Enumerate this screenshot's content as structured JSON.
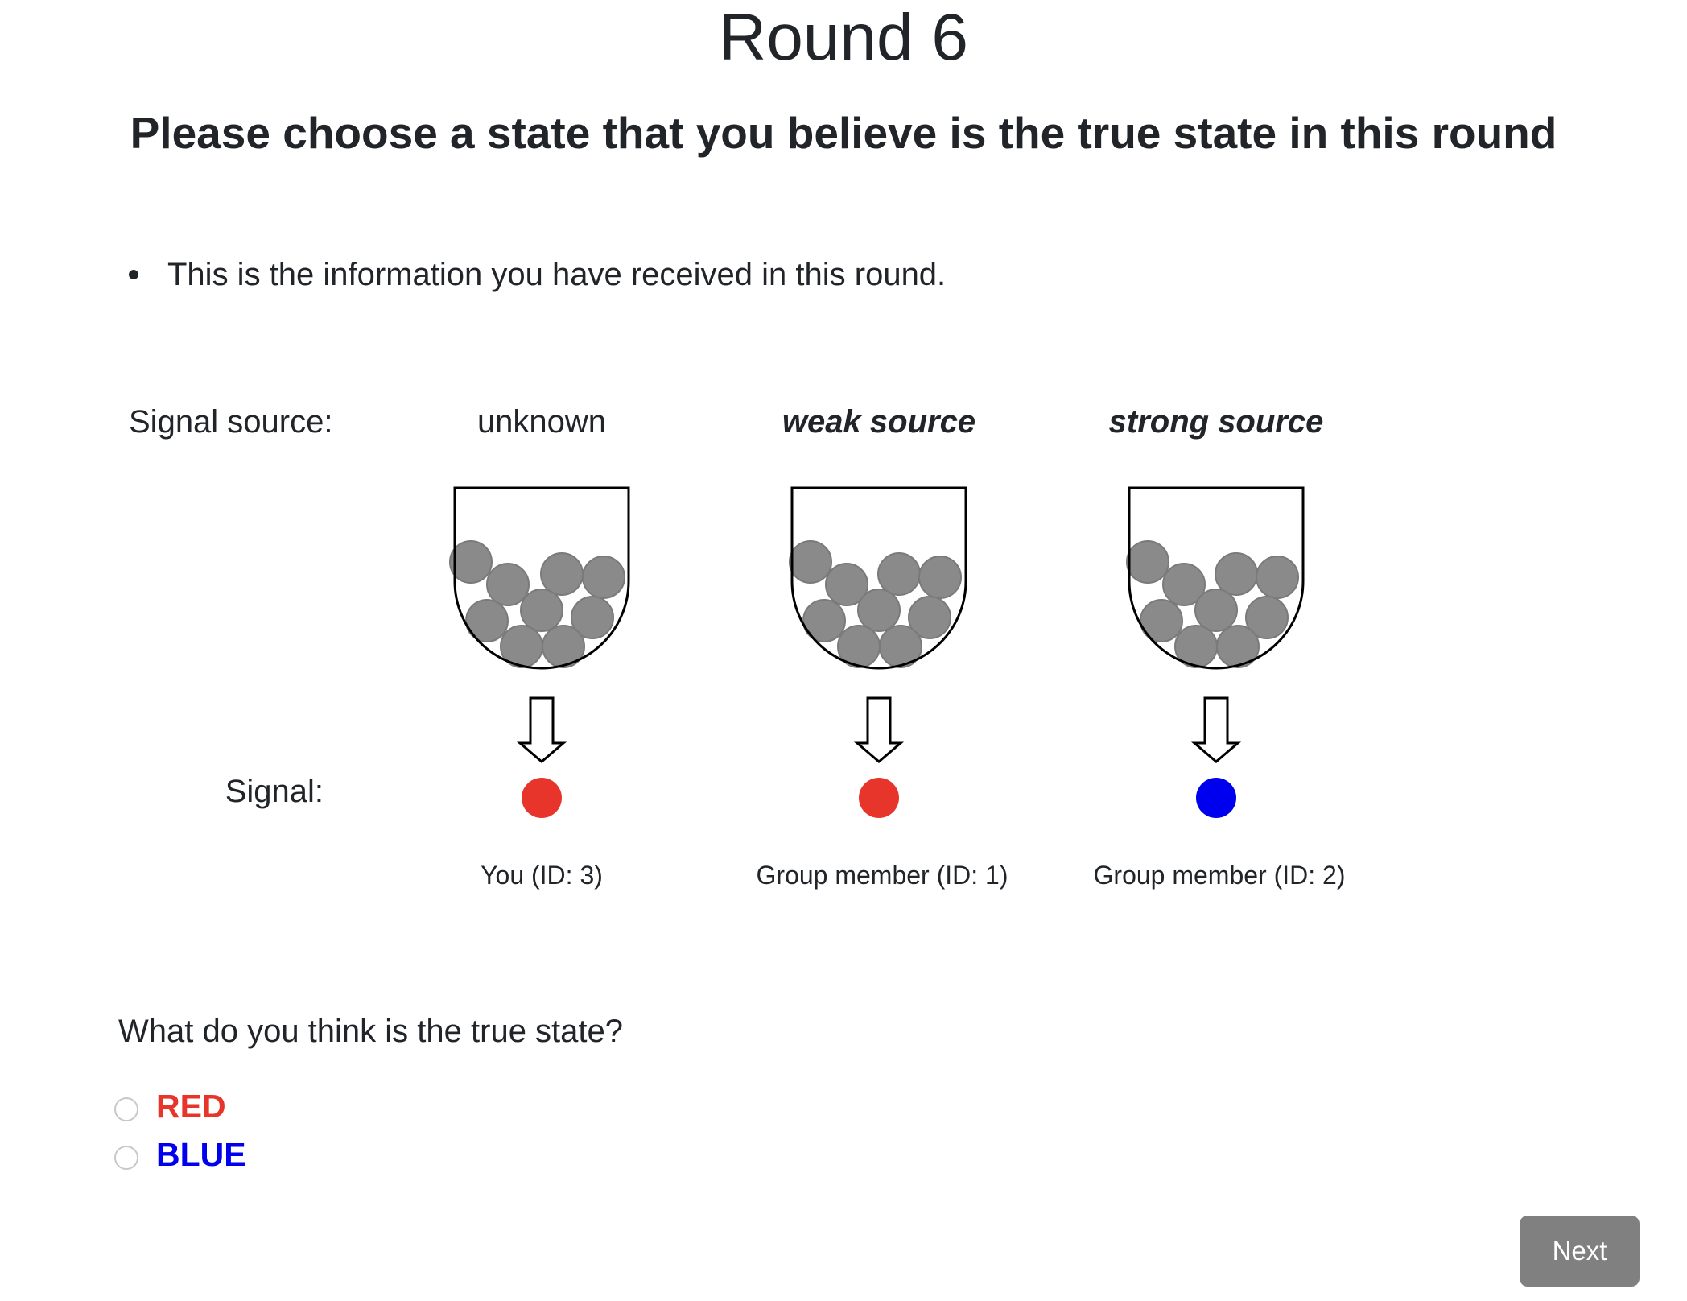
{
  "page": {
    "title": "Round 6",
    "instruction": "Please choose a state that you believe is the true state in this round",
    "info_bullet": "This is the information you have received in this round."
  },
  "signal_table": {
    "source_row_label": "Signal source:",
    "signal_row_label": "Signal:",
    "columns": [
      {
        "source": "unknown",
        "emphasis": false,
        "signal_color": "#e8352b",
        "member": "You (ID: 3)"
      },
      {
        "source": "weak source",
        "emphasis": true,
        "signal_color": "#e8352b",
        "member": "Group member (ID: 1)"
      },
      {
        "source": "strong source",
        "emphasis": true,
        "signal_color": "#0000ee",
        "member": "Group member (ID: 2)"
      }
    ],
    "ball_color": "#8a8a8a",
    "icons": [
      "urn-icon",
      "down-arrow-icon",
      "signal-dot-icon"
    ]
  },
  "question": {
    "text": "What do you think is the true state?",
    "options": [
      {
        "label": "RED",
        "color": "#e8352b",
        "selected": false
      },
      {
        "label": "BLUE",
        "color": "#0000ee",
        "selected": false
      }
    ]
  },
  "actions": {
    "next_label": "Next",
    "next_color": "#808080"
  }
}
